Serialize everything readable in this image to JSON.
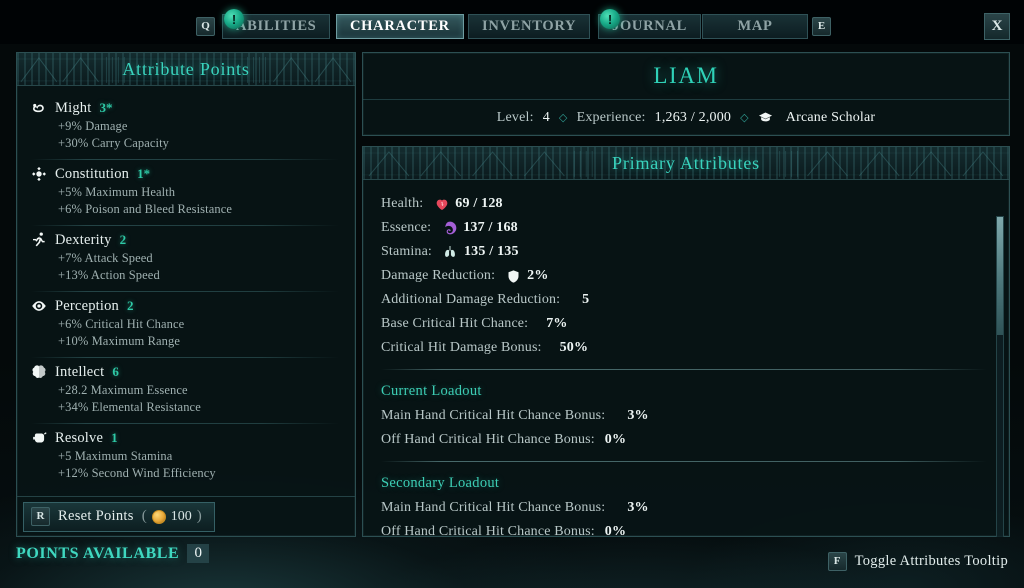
{
  "topbar": {
    "key_abilities": "Q",
    "key_map": "E",
    "close_label": "X",
    "badge_glyph": "!",
    "tabs": [
      {
        "label": "ABILITIES",
        "active": false
      },
      {
        "label": "CHARACTER",
        "active": true
      },
      {
        "label": "INVENTORY",
        "active": false
      },
      {
        "label": "JOURNAL",
        "active": false
      },
      {
        "label": "MAP",
        "active": false
      }
    ]
  },
  "attribute_points": {
    "title": "Attribute Points",
    "items": [
      {
        "icon": "muscle-icon",
        "name": "Might",
        "value": "3*",
        "bonus1": "+9% Damage",
        "bonus2": "+30% Carry Capacity"
      },
      {
        "icon": "shield-orb-icon",
        "name": "Constitution",
        "value": "1*",
        "bonus1": "+5% Maximum Health",
        "bonus2": "+6% Poison and Bleed Resistance"
      },
      {
        "icon": "runner-icon",
        "name": "Dexterity",
        "value": "2",
        "bonus1": "+7% Attack Speed",
        "bonus2": "+13% Action Speed"
      },
      {
        "icon": "eye-icon",
        "name": "Perception",
        "value": "2",
        "bonus1": "+6% Critical Hit Chance",
        "bonus2": "+10% Maximum Range"
      },
      {
        "icon": "brain-icon",
        "name": "Intellect",
        "value": "6",
        "bonus1": "+28.2 Maximum Essence",
        "bonus2": "+34% Elemental Resistance"
      },
      {
        "icon": "fist-icon",
        "name": "Resolve",
        "value": "1",
        "bonus1": "+5 Maximum Stamina",
        "bonus2": "+12% Second Wind Efficiency"
      }
    ],
    "reset": {
      "key": "R",
      "label": "Reset Points",
      "paren_open": "(",
      "paren_close": ")",
      "coin_icon": "gold-coin-icon",
      "cost": "100"
    }
  },
  "points_available": {
    "label": "POINTS AVAILABLE",
    "value": "0"
  },
  "character": {
    "name": "LIAM",
    "level_label": "Level:",
    "level_value": "4",
    "experience_label": "Experience:",
    "experience_value": "1,263 / 2,000",
    "class_icon": "scholar-hat-icon",
    "class_name": "Arcane Scholar",
    "separator": "◇"
  },
  "primary_attributes": {
    "title": "Primary Attributes",
    "stats": [
      {
        "label": "Health:",
        "icon": "heart-icon",
        "value": "69 / 128"
      },
      {
        "label": "Essence:",
        "icon": "essence-icon",
        "value": "137 / 168"
      },
      {
        "label": "Stamina:",
        "icon": "lungs-icon",
        "value": "135 / 135"
      },
      {
        "label": "Damage Reduction:",
        "icon": "shield-icon",
        "value": "2%"
      },
      {
        "label": "Additional Damage Reduction:",
        "icon": "",
        "value": "5"
      },
      {
        "label": "Base Critical Hit Chance:",
        "icon": "",
        "value": "7%"
      },
      {
        "label": "Critical Hit Damage Bonus:",
        "icon": "",
        "value": "50%"
      }
    ],
    "loadouts": [
      {
        "title": "Current Loadout",
        "rows": [
          {
            "label": "Main Hand Critical Hit Chance Bonus:",
            "value": "3%"
          },
          {
            "label": "Off Hand Critical Hit Chance Bonus:",
            "value": "0%"
          }
        ]
      },
      {
        "title": "Secondary Loadout",
        "rows": [
          {
            "label": "Main Hand Critical Hit Chance Bonus:",
            "value": "3%"
          },
          {
            "label": "Off Hand Critical Hit Chance Bonus:",
            "value": "0%"
          }
        ]
      }
    ]
  },
  "footer_hint": {
    "key": "F",
    "label": "Toggle Attributes Tooltip"
  },
  "colors": {
    "accent_teal": "#2fd2b8",
    "text_primary": "#eef5f4",
    "text_muted": "#b9c8c8",
    "panel_border": "#2c4f52",
    "health_red": "#e5485c",
    "essence_purple": "#a martians"
  }
}
